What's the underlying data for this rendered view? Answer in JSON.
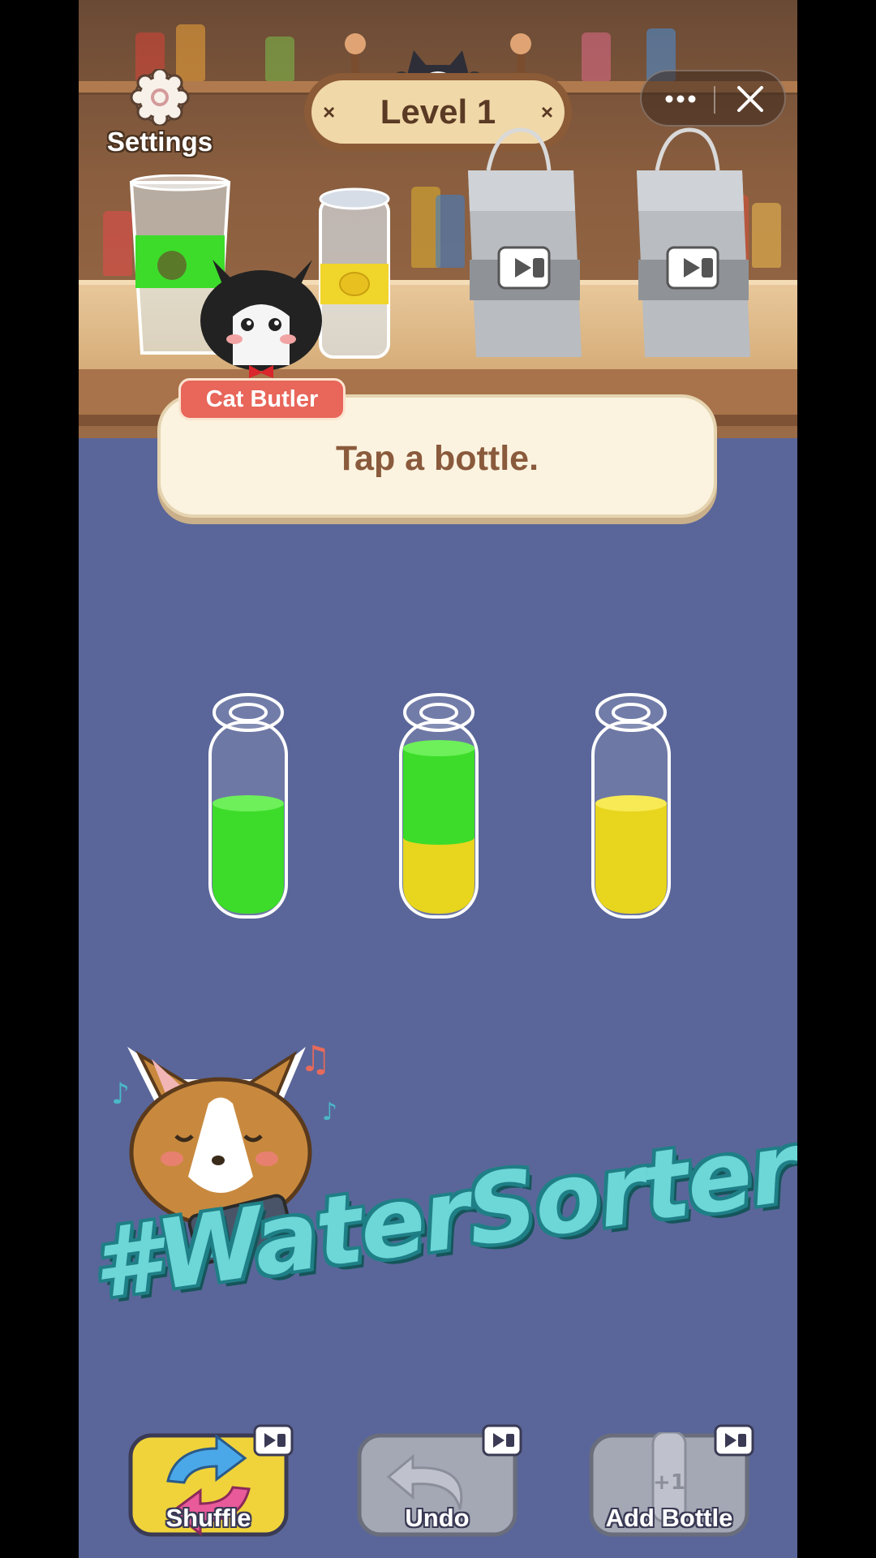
{
  "header": {
    "settings_label": "Settings",
    "level_label": "Level 1"
  },
  "capsule": {
    "more_icon": "more-icon",
    "close_icon": "close-icon"
  },
  "character": {
    "name_tag": "Cat Butler",
    "dialog": "Tap a bottle."
  },
  "bottles": [
    {
      "layers_bottom_to_top": [
        "green"
      ]
    },
    {
      "layers_bottom_to_top": [
        "yellow",
        "green"
      ]
    },
    {
      "layers_bottom_to_top": [
        "yellow"
      ]
    }
  ],
  "hashtag": "#WaterSorter",
  "tools": [
    {
      "label": "Shuffle",
      "icon": "shuffle-icon",
      "video_ad": true
    },
    {
      "label": "Undo",
      "icon": "undo-icon",
      "video_ad": true
    },
    {
      "label": "Add Bottle",
      "icon": "add-bottle-icon",
      "video_ad": true
    }
  ],
  "colors": {
    "background": "#5a6699",
    "liquid_green": "#3ddc2a",
    "liquid_yellow": "#e8d51e",
    "hashtag": "#6dd6d6"
  }
}
